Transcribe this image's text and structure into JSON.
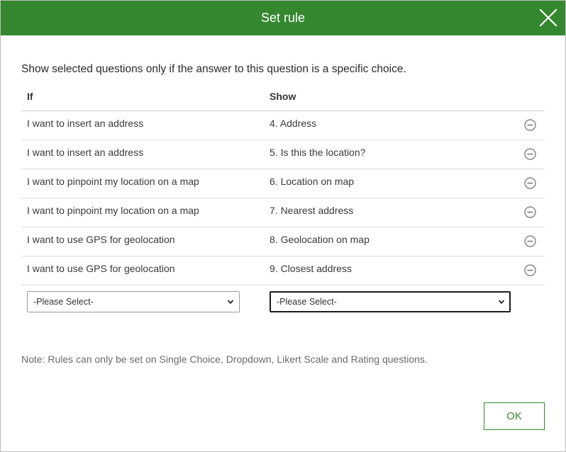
{
  "dialog": {
    "title": "Set rule",
    "close_icon": "close-icon",
    "description": "Show selected questions only if the answer to this question is a specific choice.",
    "table": {
      "headers": {
        "if": "If",
        "show": "Show"
      },
      "rows": [
        {
          "if": "I want to insert an address",
          "show": "4. Address"
        },
        {
          "if": "I want to insert an address",
          "show": "5. Is this the location?"
        },
        {
          "if": "I want to pinpoint my location on a map",
          "show": "6. Location on map"
        },
        {
          "if": "I want to pinpoint my location on a map",
          "show": "7. Nearest address"
        },
        {
          "if": "I want to use GPS for geolocation",
          "show": "8. Geolocation on map"
        },
        {
          "if": "I want to use GPS for geolocation",
          "show": "9. Closest address"
        }
      ],
      "remove_icon": "minus-circle-icon"
    },
    "selects": {
      "if_value": "-Please Select-",
      "show_value": "-Please Select-"
    },
    "note": "Note: Rules can only be set on Single Choice, Dropdown, Likert Scale and Rating questions.",
    "ok_label": "OK",
    "colors": {
      "header_bg": "#35872f",
      "accent": "#35872f",
      "text": "#323232",
      "muted": "#6a6a6a"
    }
  }
}
